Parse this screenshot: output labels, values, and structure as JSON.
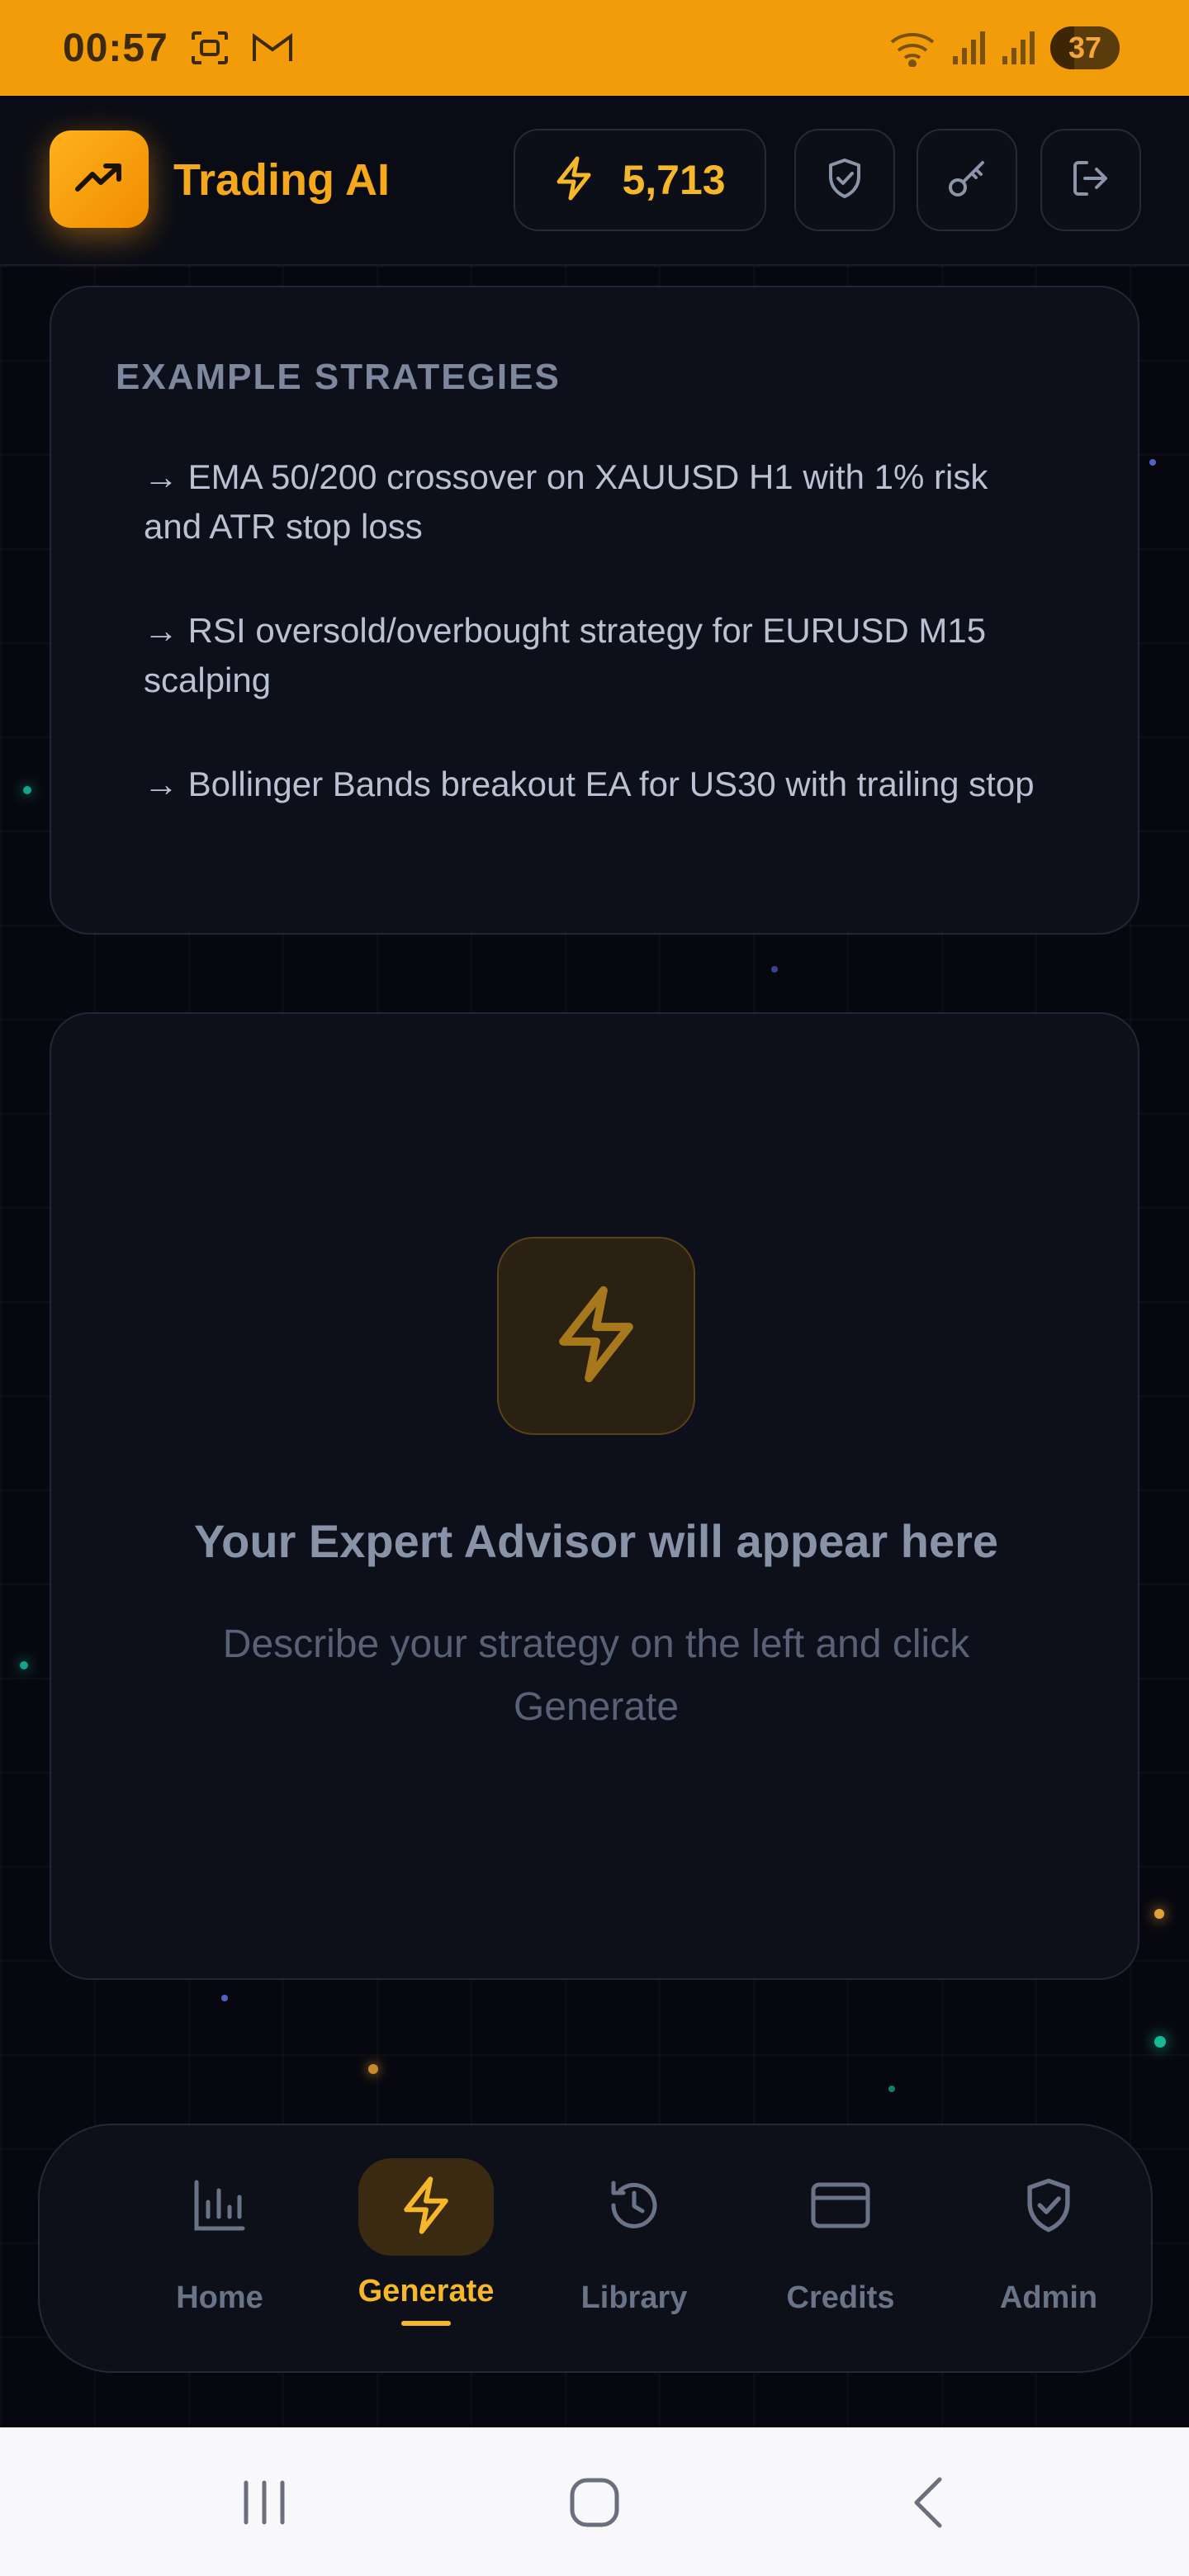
{
  "status_bar": {
    "time": "00:57",
    "battery": "37",
    "icons": [
      "screenshot-icon",
      "gmail-icon",
      "wifi-icon",
      "signal-icon",
      "signal-icon"
    ]
  },
  "header": {
    "title": "Trading AI",
    "logo_icon": "trending-up-icon",
    "credits": "5,713",
    "credits_icon": "bolt-icon",
    "buttons": [
      "shield-icon",
      "key-icon",
      "logout-icon"
    ]
  },
  "examples": {
    "title": "EXAMPLE STRATEGIES",
    "items": [
      "→ EMA 50/200 crossover on XAUUSD H1 with 1% risk and ATR stop loss",
      "→ RSI oversold/overbought strategy for EURUSD M15 scalping",
      "→ Bollinger Bands breakout EA for US30 with trailing stop"
    ]
  },
  "output": {
    "title": "Your Expert Advisor will appear here",
    "subtitle": "Describe your strategy on the left and click Generate"
  },
  "nav": {
    "items": [
      {
        "label": "Home",
        "icon": "bar-chart-icon"
      },
      {
        "label": "Generate",
        "icon": "bolt-icon",
        "active": true
      },
      {
        "label": "Library",
        "icon": "history-icon"
      },
      {
        "label": "Credits",
        "icon": "credit-card-icon"
      },
      {
        "label": "Admin",
        "icon": "shield-check-icon"
      }
    ]
  },
  "colors": {
    "accent": "#f6b82a",
    "status_bar": "#f39c0a",
    "background": "#07080f"
  }
}
